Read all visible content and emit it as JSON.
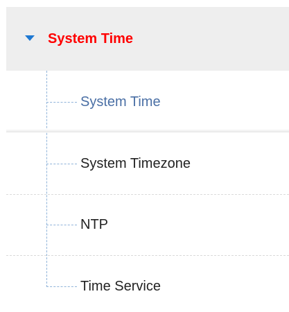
{
  "nav": {
    "group": {
      "title": "System Time",
      "expanded": true,
      "caret_icon": "caret-down-icon",
      "title_color": "#ff0000",
      "caret_color": "#1e78d2"
    },
    "items": [
      {
        "label": "System Time",
        "active": true
      },
      {
        "label": "System Timezone",
        "active": false
      },
      {
        "label": "NTP",
        "active": false
      },
      {
        "label": "Time Service",
        "active": false
      }
    ],
    "colors": {
      "active_text": "#4a6fa5",
      "text": "#222222",
      "header_bg": "#eeeeee",
      "tree_line": "#8fb3d9"
    }
  }
}
